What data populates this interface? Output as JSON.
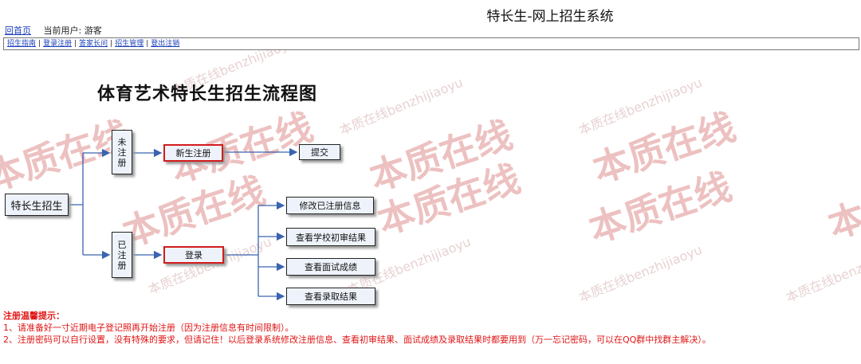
{
  "header": {
    "site_title": "特长生-网上招生系统",
    "home_link": "回首页",
    "current_user": "当前用户: 游客"
  },
  "nav": {
    "items": [
      "招生指南",
      "登录注册",
      "答家长问",
      "招生管理",
      "登出注销"
    ]
  },
  "flowchart": {
    "title": "体育艺术特长生招生流程图",
    "root": "特长生招生",
    "unregistered": [
      "未",
      "注",
      "册"
    ],
    "registered": [
      "已",
      "注",
      "册"
    ],
    "new_register": "新生注册",
    "submit": "提交",
    "login": "登录",
    "actions": [
      "修改已注册信息",
      "查看学校初审结果",
      "查看面试成绩",
      "查看录取结果"
    ]
  },
  "notice": {
    "heading": "注册温馨提示：",
    "lines": [
      "1、请准备好一寸近期电子登记照再开始注册（因为注册信息有时间限制）。",
      "2、注册密码可以自行设置，没有特殊的要求，但请记住！以后登录系统修改注册信息、查看初审结果、面试成绩及录取结果时都要用到（万一忘记密码，可以在QQ群中找群主解决）。"
    ]
  },
  "watermark": {
    "cn": "本质在线",
    "small": "本质在线benzhijiaoyu"
  },
  "colors": {
    "link": "#1a3fb8",
    "notice": "#e01515",
    "box_fill": "#eef3fb",
    "highlight_border": "#d21c1c",
    "connector": "#3a64b0",
    "watermark": "#e08f8f"
  }
}
